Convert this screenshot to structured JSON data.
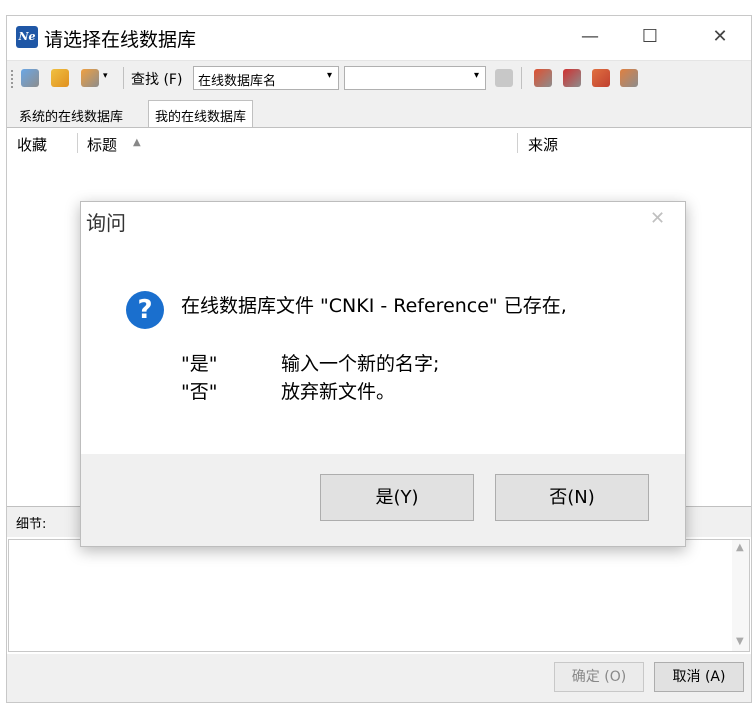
{
  "window": {
    "title": "请选择在线数据库",
    "app_icon_text": "Ne",
    "minimize_glyph": "—",
    "maximize_glyph": "☐",
    "close_glyph": "✕"
  },
  "toolbar": {
    "find_label": "查找 (F)",
    "field_combo_value": "在线数据库名",
    "search_combo_value": "",
    "dropdown_glyph": "▾"
  },
  "tabs": [
    "系统的在线数据库",
    "我的在线数据库"
  ],
  "list": {
    "columns": [
      "收藏",
      "标题",
      "来源"
    ],
    "sort_glyph": "▲"
  },
  "details": {
    "label": "细节:"
  },
  "footer": {
    "ok_label": "确定 (O)",
    "cancel_label": "取消 (A)"
  },
  "dialog": {
    "title": "询问",
    "close_glyph": "✕",
    "icon_glyph": "?",
    "message": "在线数据库文件 \"CNKI - Reference\" 已存在,",
    "yes_key": "\"是\"",
    "yes_desc": "输入一个新的名字;",
    "no_key": "\"否\"",
    "no_desc": "放弃新文件。",
    "yes_button": "是(Y)",
    "no_button": "否(N)"
  },
  "colors": {
    "dialog_icon": "#1a6fce",
    "app_icon": "#1f57a6",
    "toolbar_bg": "#f0f0f0"
  }
}
